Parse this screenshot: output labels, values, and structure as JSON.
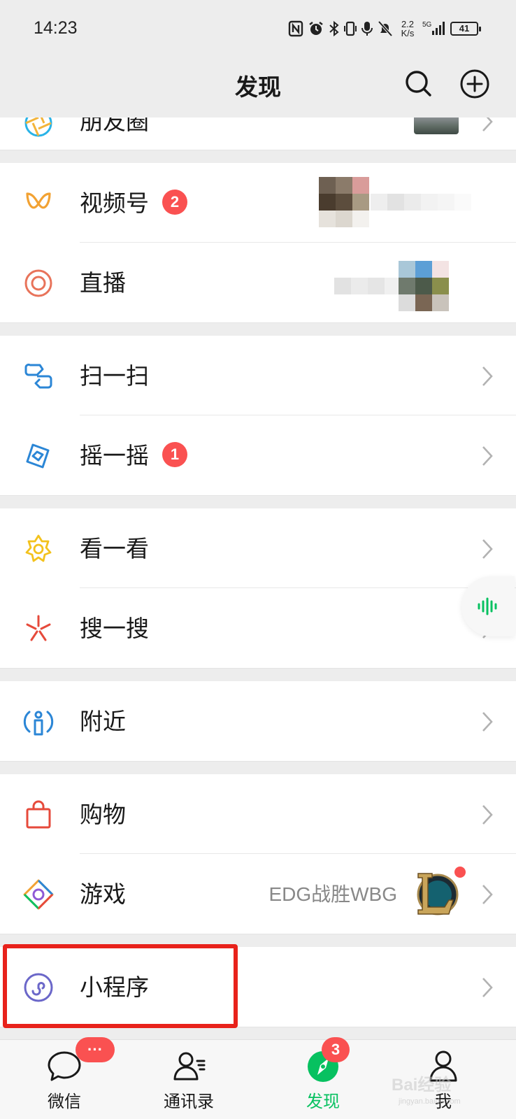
{
  "status_bar": {
    "time": "14:23",
    "net_speed_value": "2.2",
    "net_speed_unit": "K/s",
    "signal_label": "5G",
    "battery": "41"
  },
  "header": {
    "title": "发现",
    "search_icon": "search-icon",
    "add_icon": "plus-circle-icon"
  },
  "sections": {
    "moments": {
      "label": "朋友圈",
      "icon": "moments-icon"
    },
    "channels": {
      "label": "视频号",
      "icon": "channels-icon",
      "badge": "2"
    },
    "live": {
      "label": "直播",
      "icon": "live-icon"
    },
    "scan": {
      "label": "扫一扫",
      "icon": "scan-icon"
    },
    "shake": {
      "label": "摇一摇",
      "icon": "shake-icon",
      "badge": "1"
    },
    "top_stories": {
      "label": "看一看",
      "icon": "top-stories-icon"
    },
    "search": {
      "label": "搜一搜",
      "icon": "search-spark-icon"
    },
    "nearby": {
      "label": "附近",
      "icon": "nearby-icon"
    },
    "shopping": {
      "label": "购物",
      "icon": "shopping-bag-icon"
    },
    "games": {
      "label": "游戏",
      "icon": "games-icon",
      "subtitle": "EDG战胜WBG"
    },
    "mini_programs": {
      "label": "小程序",
      "icon": "mini-program-icon"
    }
  },
  "tabbar": {
    "chats": {
      "label": "微信",
      "badge": "···",
      "icon": "chat-bubble-icon"
    },
    "contacts": {
      "label": "通讯录",
      "icon": "contacts-icon"
    },
    "discover": {
      "label": "发现",
      "badge": "3",
      "icon": "compass-icon"
    },
    "me": {
      "label": "我",
      "icon": "person-icon"
    }
  },
  "watermark": {
    "text": "Bai经验",
    "sub": "jingyan.baidu.com"
  },
  "colors": {
    "accent_green": "#07c160",
    "badge_red": "#fa5151",
    "highlight_red": "#e8221b",
    "background": "#ededed"
  }
}
